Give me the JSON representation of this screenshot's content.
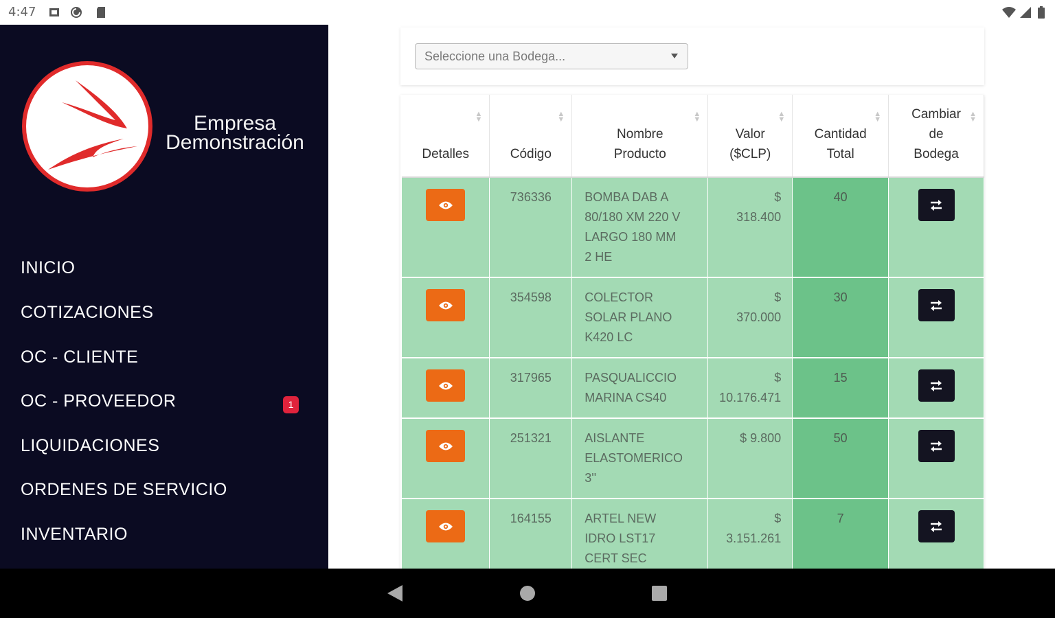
{
  "status_bar": {
    "time": "4:47"
  },
  "sidebar": {
    "company_name_line1": "Empresa",
    "company_name_line2": "Demonstración",
    "menu": [
      {
        "label": "INICIO"
      },
      {
        "label": "COTIZACIONES"
      },
      {
        "label": "OC - CLIENTE"
      },
      {
        "label": "OC - PROVEEDOR",
        "badge": "1"
      },
      {
        "label": "LIQUIDACIONES"
      },
      {
        "label": "ORDENES DE SERVICIO"
      },
      {
        "label": "INVENTARIO"
      }
    ]
  },
  "filter": {
    "placeholder": "Seleccione una Bodega..."
  },
  "table": {
    "headers": {
      "detalles": "Detalles",
      "codigo": "Código",
      "nombre_1": "Nombre",
      "nombre_2": "Producto",
      "valor_1": "Valor",
      "valor_2": "($CLP)",
      "cantidad_1": "Cantidad",
      "cantidad_2": "Total",
      "cambiar_1": "Cambiar",
      "cambiar_2": "de",
      "cambiar_3": "Bodega"
    },
    "rows": [
      {
        "code": "736336",
        "name": [
          "BOMBA DAB A",
          "80/180 XM 220 V",
          "LARGO 180 MM",
          "2 HE"
        ],
        "value": [
          "$",
          "318.400"
        ],
        "qty": "40"
      },
      {
        "code": "354598",
        "name": [
          "COLECTOR",
          "SOLAR PLANO",
          "K420 LC"
        ],
        "value": [
          "$",
          "370.000"
        ],
        "qty": "30"
      },
      {
        "code": "317965",
        "name": [
          "PASQUALICCIO",
          "MARINA CS40"
        ],
        "value": [
          "$",
          "10.176.471"
        ],
        "qty": "15"
      },
      {
        "code": "251321",
        "name": [
          "AISLANTE",
          "ELASTOMERICO",
          "3''"
        ],
        "value": [
          "$ 9.800"
        ],
        "qty": "50"
      },
      {
        "code": "164155",
        "name": [
          "ARTEL NEW",
          "IDRO LST17",
          "CERT SEC"
        ],
        "value": [
          "$",
          "3.151.261"
        ],
        "qty": "7"
      }
    ]
  },
  "colors": {
    "sidebar_bg": "#0b0b22",
    "row_bg": "#a3dab4",
    "qty_bg": "#6cc289",
    "eye_button": "#ec6a15",
    "swap_button": "#141421",
    "badge": "#e0233c",
    "logo_red": "#e02b2b"
  },
  "icons": [
    "eye-icon",
    "swap-arrows-icon",
    "back-icon",
    "home-icon",
    "recents-icon",
    "wifi-icon",
    "signal-icon",
    "battery-icon"
  ]
}
